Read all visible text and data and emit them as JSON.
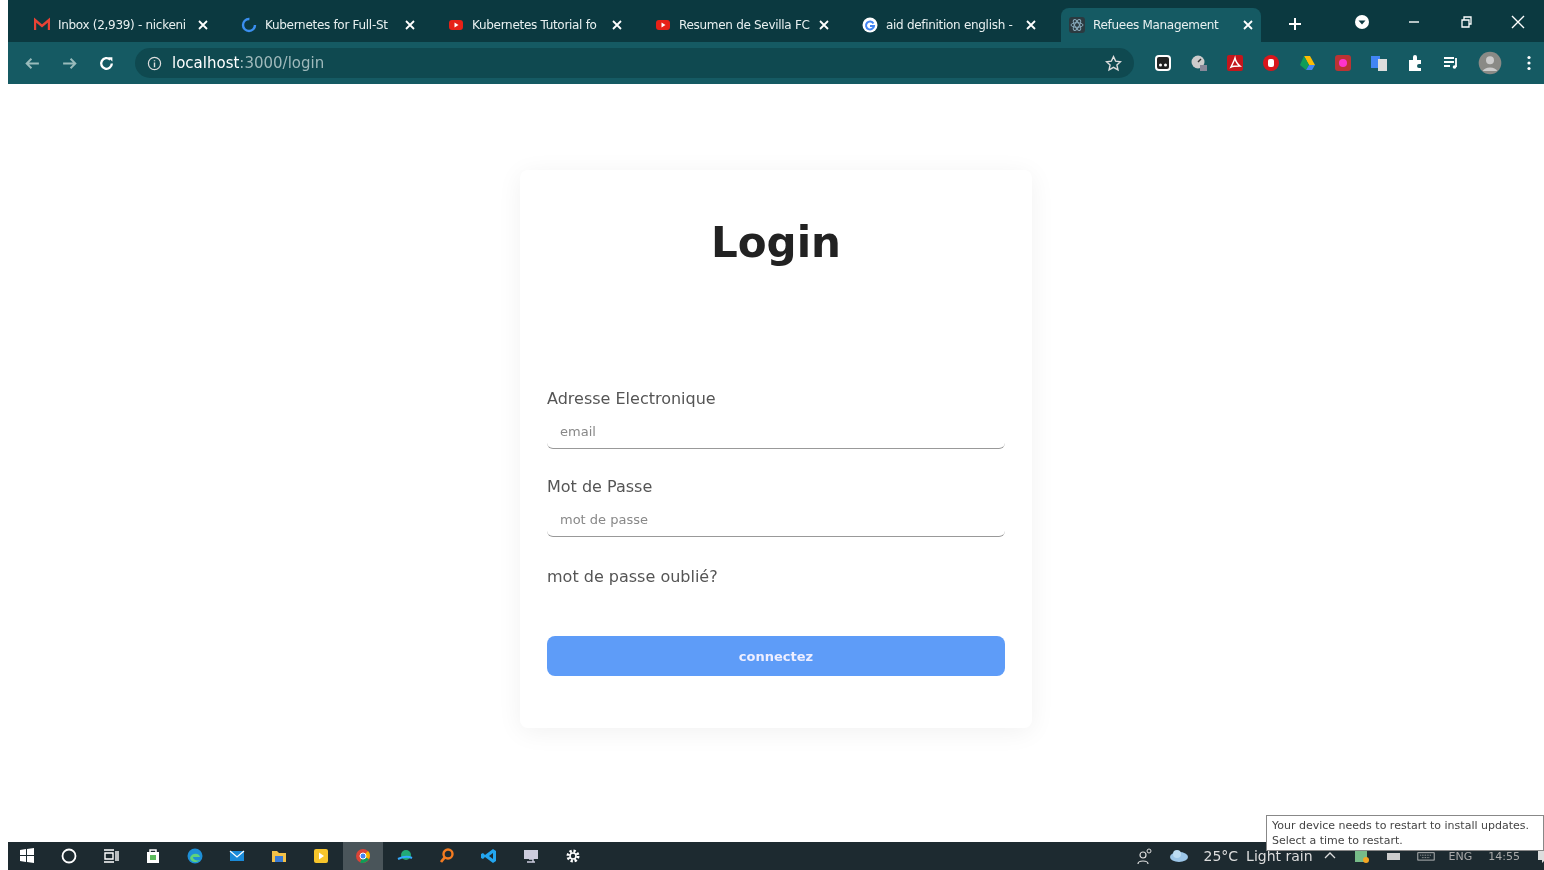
{
  "browser": {
    "tabs": [
      {
        "title": "Inbox (2,939) - nickeni",
        "kind": "mail",
        "selected": false
      },
      {
        "title": "Kubernetes for Full-St",
        "kind": "ring",
        "selected": false
      },
      {
        "title": "Kubernetes Tutorial fo",
        "kind": "video",
        "selected": false
      },
      {
        "title": "Resumen de Sevilla FC",
        "kind": "video",
        "selected": false
      },
      {
        "title": "aid definition english -",
        "kind": "search",
        "selected": false
      },
      {
        "title": "Refuees Management",
        "kind": "atom",
        "selected": true
      }
    ],
    "address": {
      "host": "localhost",
      "path": ":3000/login"
    }
  },
  "login": {
    "title": "Login",
    "fields": [
      {
        "label": "Adresse Electronique",
        "placeholder": "email"
      },
      {
        "label": "Mot de Passe",
        "placeholder": "mot de passe"
      }
    ],
    "forgot_link": "mot de passe oublié?",
    "submit": "connectez"
  },
  "taskbar": {
    "temperature": "25°C",
    "weather": "Light rain",
    "language": "ENG",
    "time": "14:55"
  },
  "notification": {
    "lines": [
      "Your device needs to restart to install updates.",
      "Select a time to restart."
    ]
  }
}
